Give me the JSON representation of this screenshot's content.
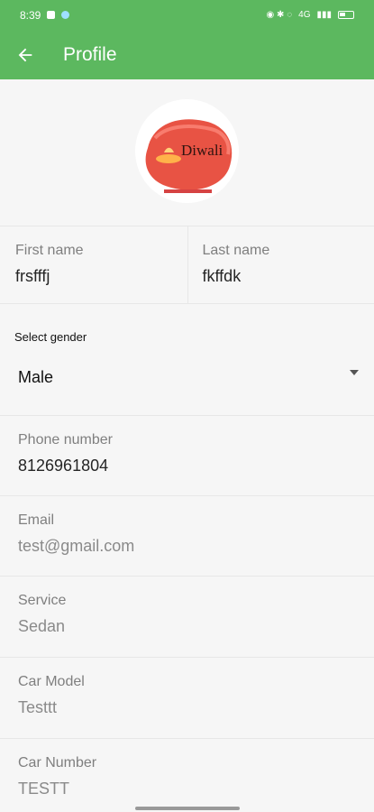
{
  "status_bar": {
    "time": "8:39",
    "right_text": "4G"
  },
  "header": {
    "title": "Profile",
    "back_icon": "arrow-left-icon"
  },
  "avatar": {
    "image_text": "Diwali"
  },
  "first_name": {
    "label": "First name",
    "value": "frsfffj"
  },
  "last_name": {
    "label": "Last name",
    "value": "fkffdk"
  },
  "gender": {
    "label": "Select gender",
    "value": "Male",
    "icon": "dropdown-triangle-icon"
  },
  "phone": {
    "label": "Phone number",
    "value": "8126961804"
  },
  "email": {
    "label": "Email",
    "value": "test@gmail.com"
  },
  "service": {
    "label": "Service",
    "value": "Sedan"
  },
  "car_model": {
    "label": "Car Model",
    "value": "Testtt"
  },
  "car_number": {
    "label": "Car Number",
    "value": "TESTT"
  },
  "colors": {
    "header_bg": "#5cb85f",
    "page_bg": "#f6f6f6",
    "label_text": "#7f7f7f",
    "accent_red": "#e74c3c"
  }
}
